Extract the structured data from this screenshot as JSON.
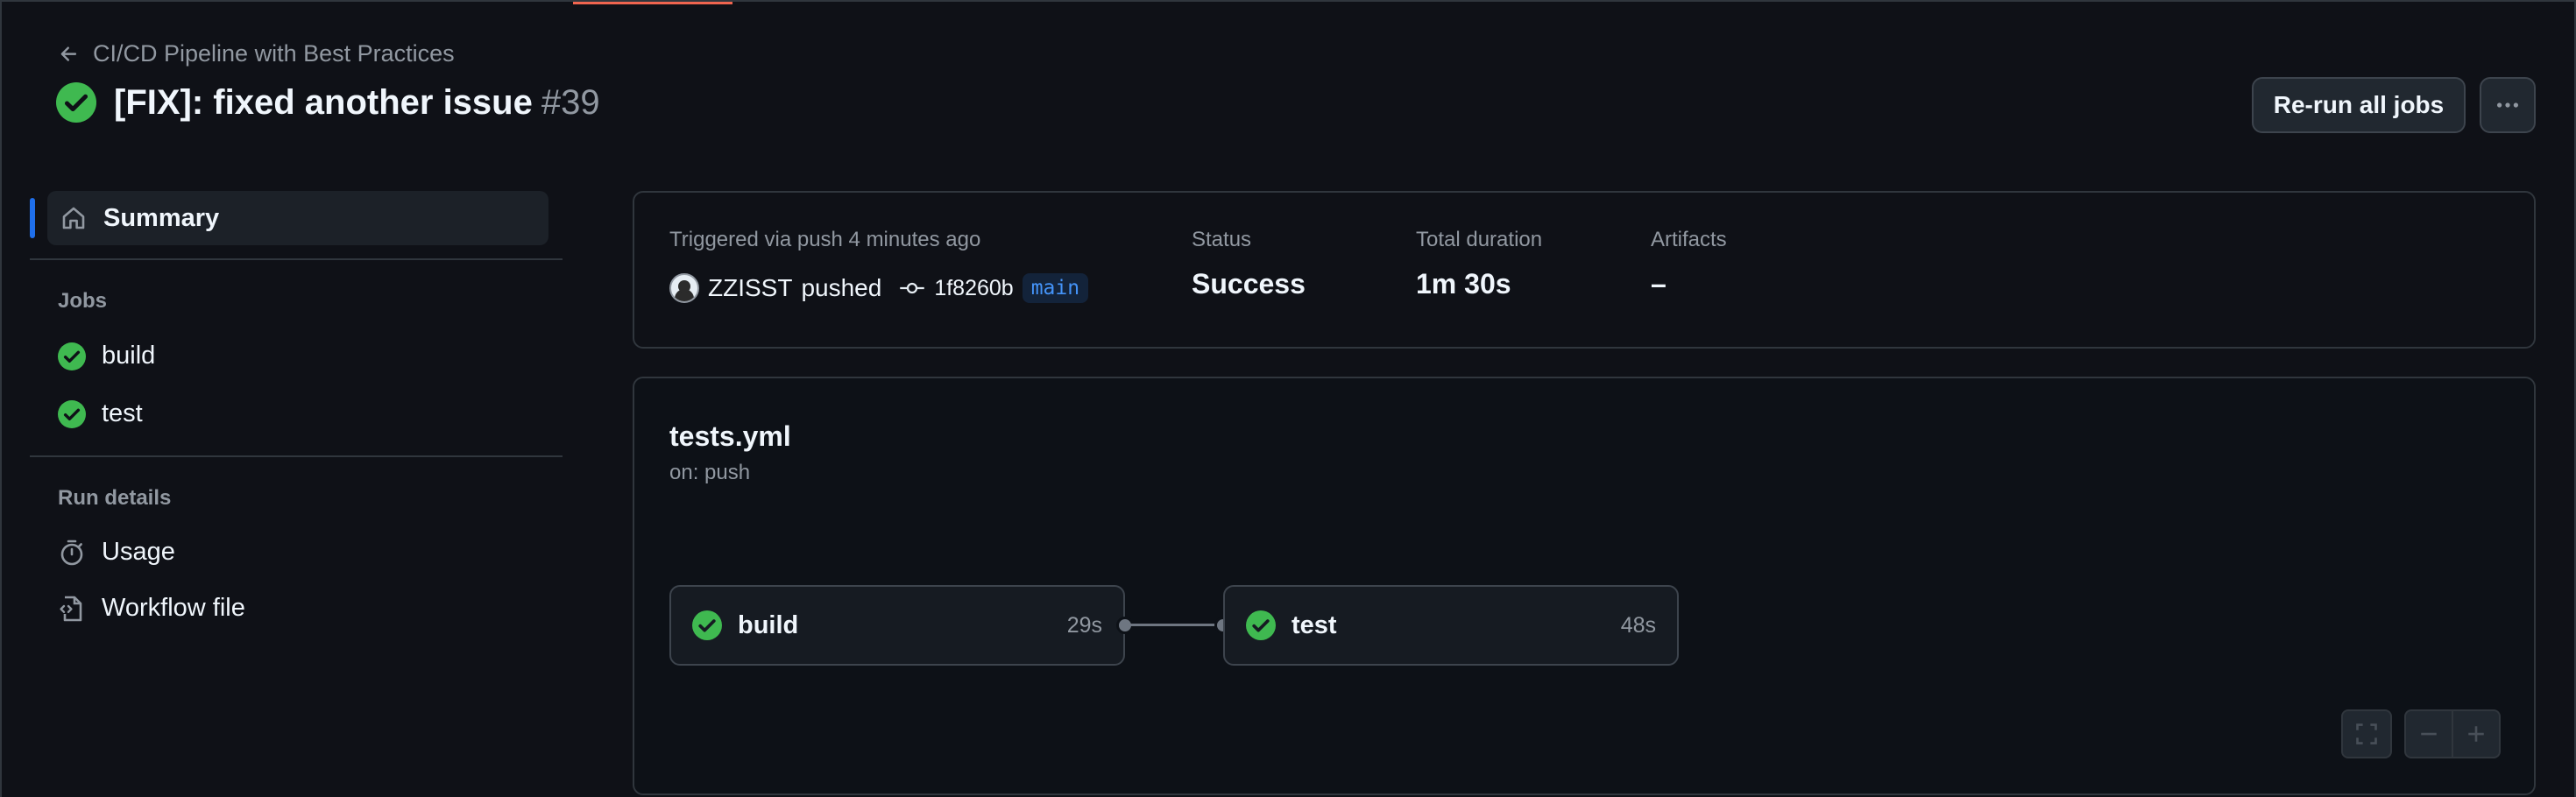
{
  "header": {
    "back_label": "CI/CD Pipeline with Best Practices",
    "run_title": "[FIX]: fixed another issue",
    "run_number": "#39",
    "rerun_label": "Re-run all jobs",
    "more_icon": "kebab-horizontal-icon"
  },
  "sidebar": {
    "summary_label": "Summary",
    "jobs_heading": "Jobs",
    "jobs": [
      {
        "label": "build",
        "status": "success"
      },
      {
        "label": "test",
        "status": "success"
      }
    ],
    "run_details_heading": "Run details",
    "run_details": [
      {
        "label": "Usage",
        "icon": "stopwatch-icon"
      },
      {
        "label": "Workflow file",
        "icon": "file-code-icon"
      }
    ]
  },
  "summary": {
    "trigger_text": "Triggered via push 4 minutes ago",
    "actor": "ZZISST",
    "action": "pushed",
    "commit_sha": "1f8260b",
    "branch": "main",
    "status_label": "Status",
    "status_value": "Success",
    "duration_label": "Total duration",
    "duration_value": "1m 30s",
    "artifacts_label": "Artifacts",
    "artifacts_value": "–"
  },
  "graph": {
    "workflow_name": "tests.yml",
    "trigger": "on: push",
    "jobs": [
      {
        "name": "build",
        "duration": "29s",
        "status": "success"
      },
      {
        "name": "test",
        "duration": "48s",
        "status": "success"
      }
    ]
  },
  "colors": {
    "success": "#3fb950",
    "accent": "#1f6feb",
    "background": "#0f1117"
  }
}
